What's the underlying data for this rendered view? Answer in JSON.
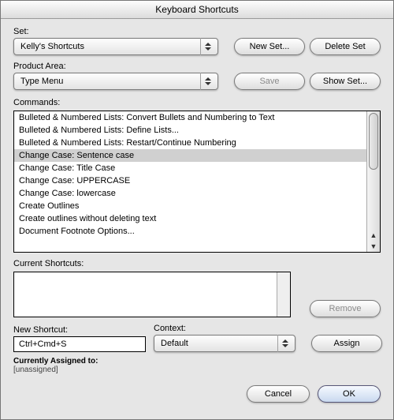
{
  "title": "Keyboard Shortcuts",
  "set": {
    "label": "Set:",
    "value": "Kelly's Shortcuts"
  },
  "productArea": {
    "label": "Product Area:",
    "value": "Type Menu"
  },
  "buttons": {
    "newSet": "New Set...",
    "deleteSet": "Delete Set",
    "save": "Save",
    "showSet": "Show Set...",
    "remove": "Remove",
    "assign": "Assign",
    "cancel": "Cancel",
    "ok": "OK"
  },
  "commands": {
    "label": "Commands:",
    "items": [
      "Bulleted & Numbered Lists: Convert Bullets and Numbering to Text",
      "Bulleted & Numbered Lists: Define Lists...",
      "Bulleted & Numbered Lists: Restart/Continue Numbering",
      "Change Case: Sentence case",
      "Change Case: Title Case",
      "Change Case: UPPERCASE",
      "Change Case: lowercase",
      "Create Outlines",
      "Create outlines without deleting text",
      "Document Footnote Options..."
    ],
    "selectedIndex": 3
  },
  "currentShortcuts": {
    "label": "Current Shortcuts:"
  },
  "newShortcut": {
    "label": "New Shortcut:",
    "value": "Ctrl+Cmd+S"
  },
  "context": {
    "label": "Context:",
    "value": "Default"
  },
  "assigned": {
    "label": "Currently Assigned to:",
    "value": "[unassigned]"
  }
}
